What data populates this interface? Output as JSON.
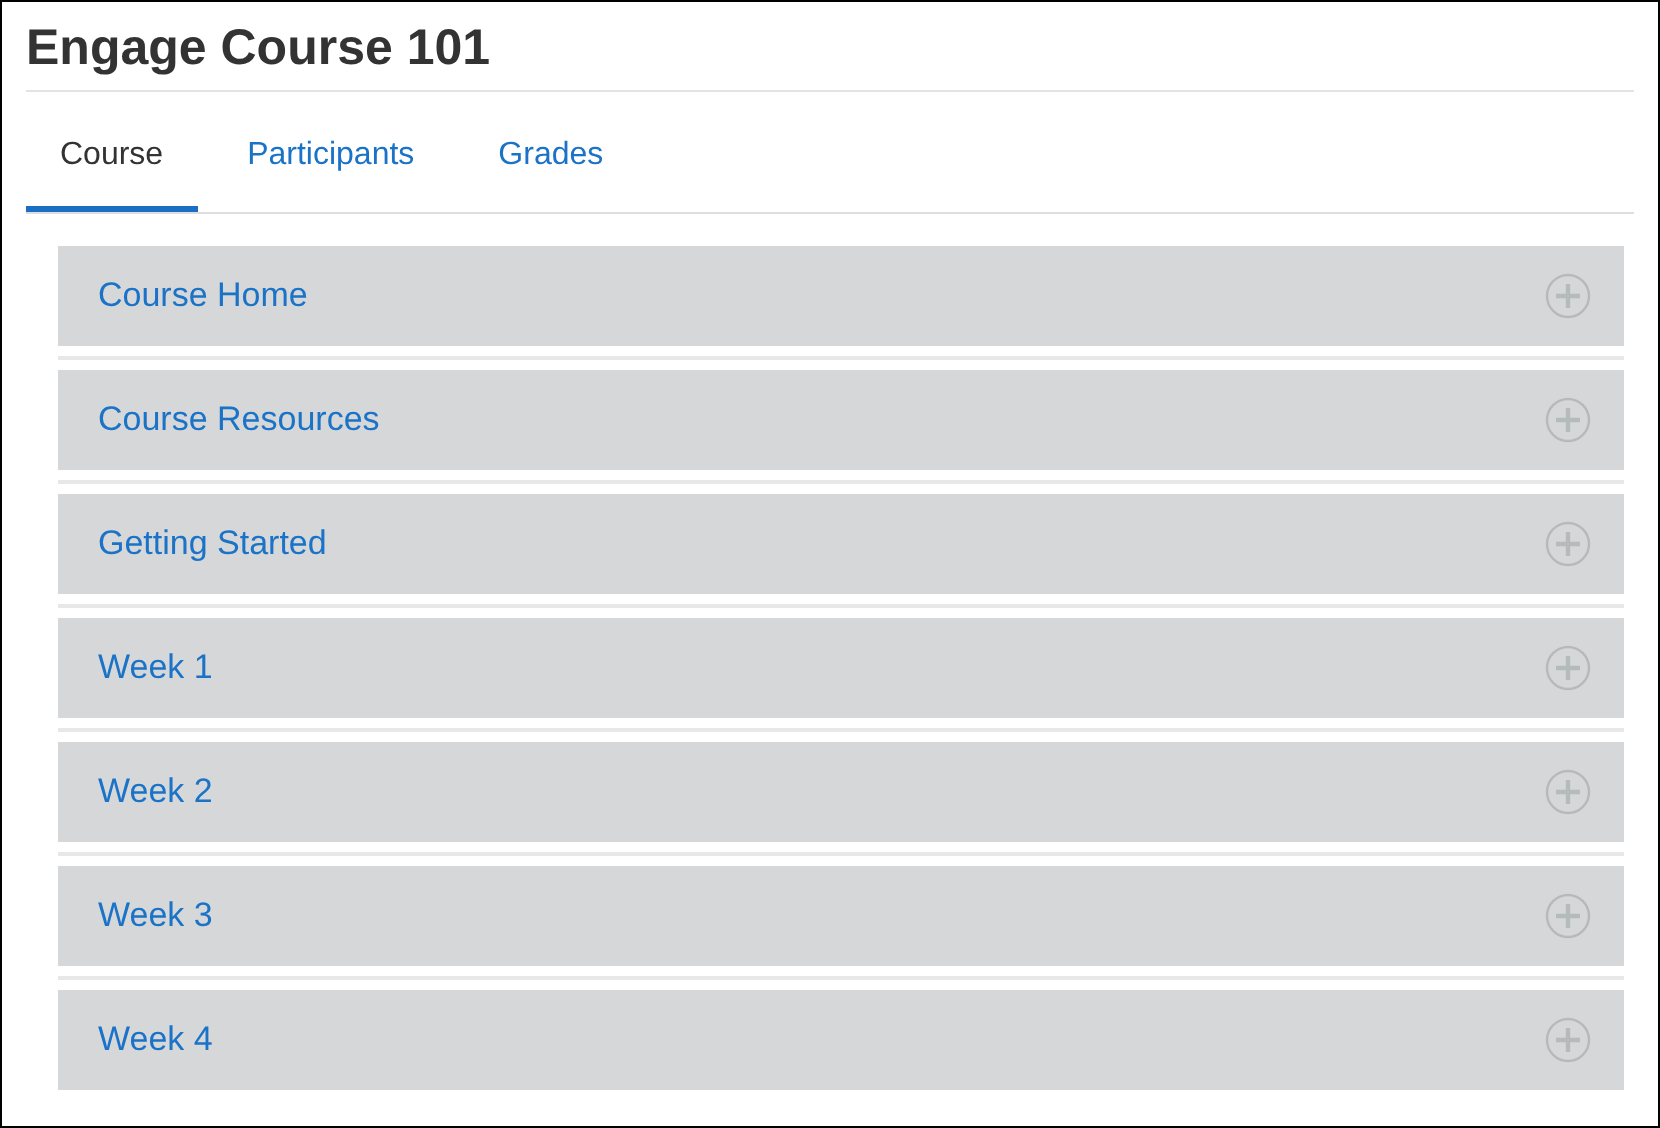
{
  "title": "Engage Course 101",
  "tabs": [
    {
      "label": "Course",
      "selected": true
    },
    {
      "label": "Participants",
      "selected": false
    },
    {
      "label": "Grades",
      "selected": false
    }
  ],
  "sections": [
    {
      "title": "Course Home",
      "expanded": false
    },
    {
      "title": "Course Resources",
      "expanded": false
    },
    {
      "title": "Getting Started",
      "expanded": false
    },
    {
      "title": "Week 1",
      "expanded": false
    },
    {
      "title": "Week 2",
      "expanded": false
    },
    {
      "title": "Week 3",
      "expanded": false
    },
    {
      "title": "Week 4",
      "expanded": false
    }
  ]
}
